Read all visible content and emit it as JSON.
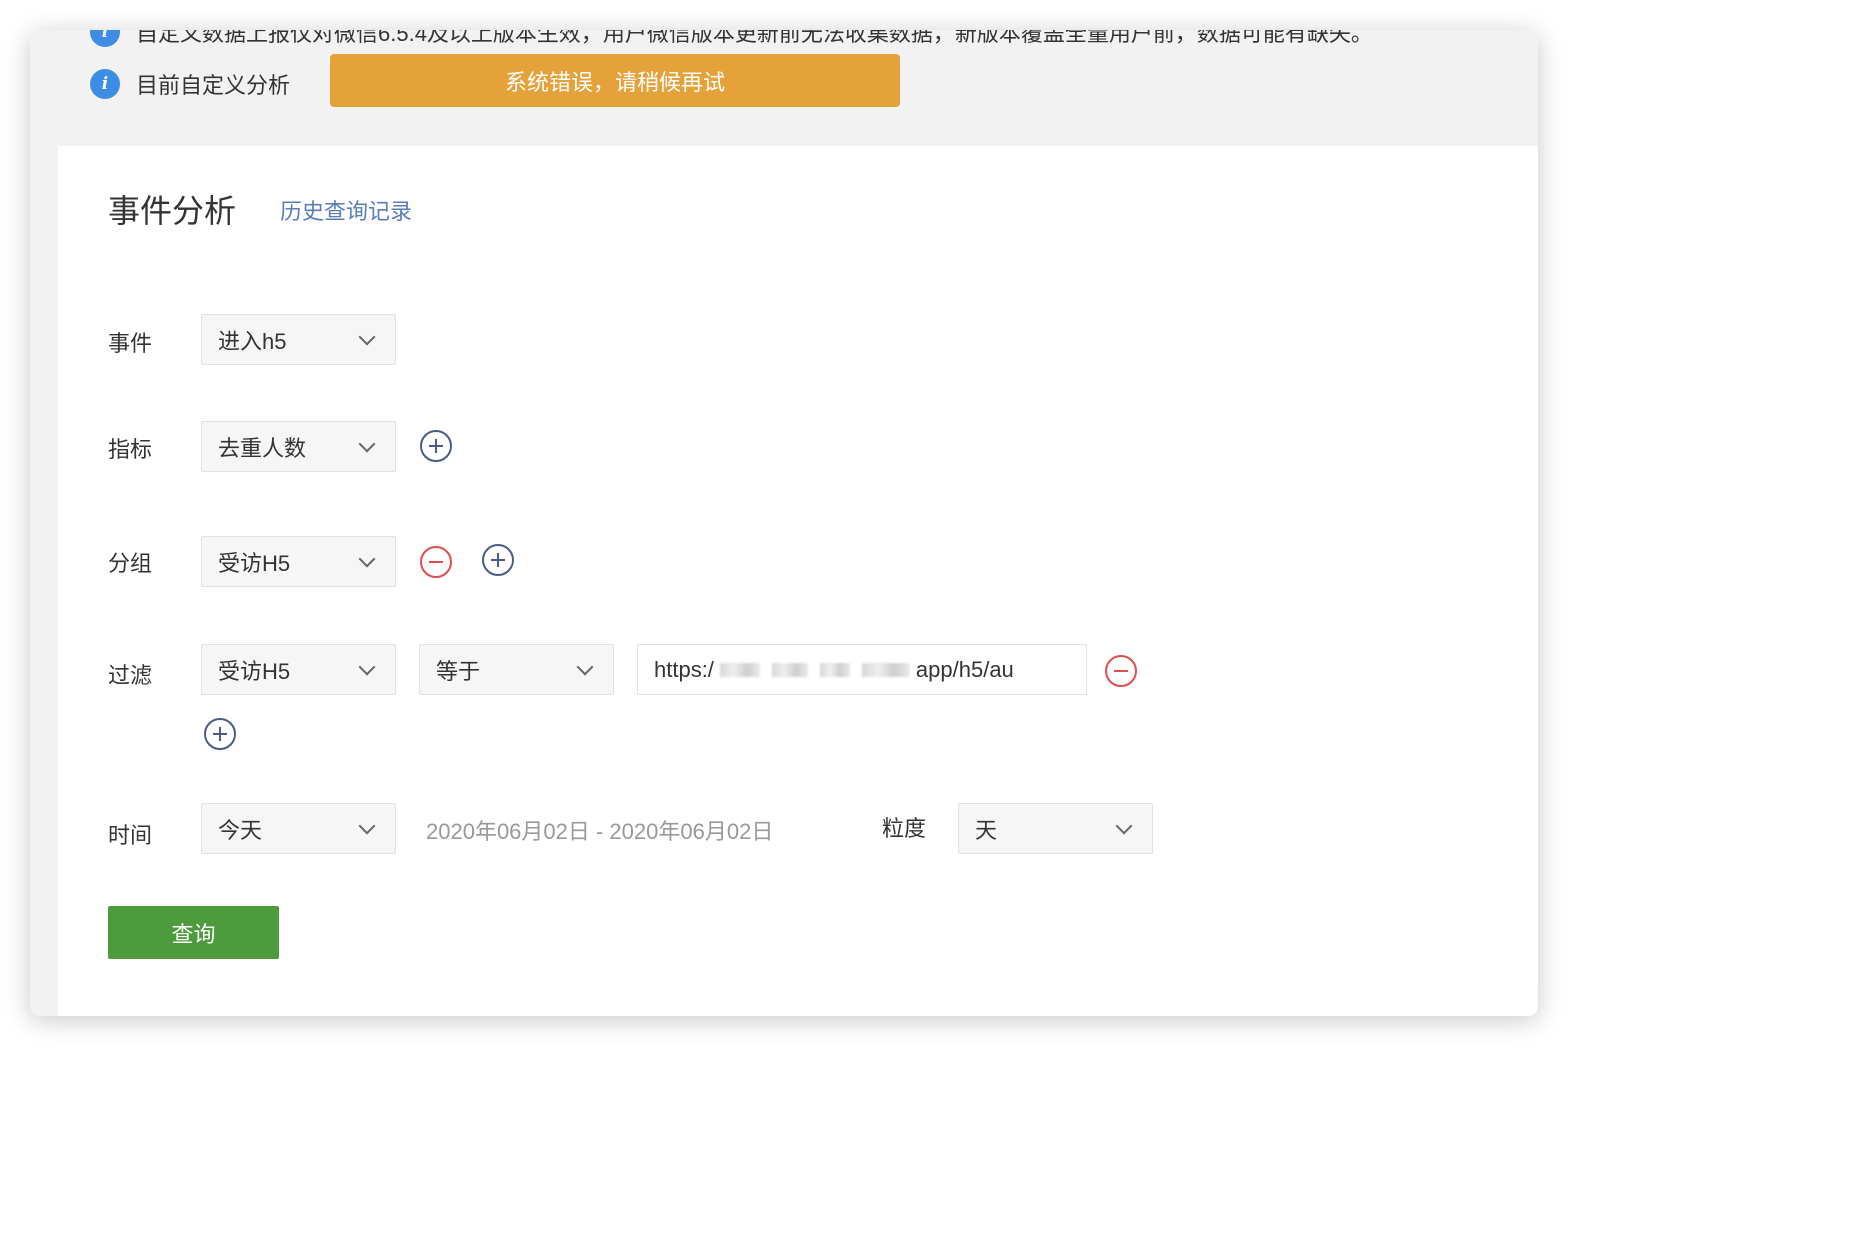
{
  "notices": [
    {
      "text": "自定义数据上报仅对微信6.5.4及以上版本生效，用户微信版本更新前无法收集数据，新版本覆盖全量用户前，数据可能有缺失。"
    },
    {
      "text": "目前自定义分析"
    }
  ],
  "toast": {
    "message": "系统错误，请稍候再试",
    "color": "#e6a23a"
  },
  "page": {
    "title": "事件分析",
    "history_link": "历史查询记录"
  },
  "event": {
    "label": "事件",
    "value": "进入h5"
  },
  "metric": {
    "label": "指标",
    "value": "去重人数"
  },
  "group": {
    "label": "分组",
    "value": "受访H5"
  },
  "filter": {
    "label": "过滤",
    "field": "受访H5",
    "operator": "等于",
    "value_prefix": "https:/",
    "value_suffix": "app/h5/au"
  },
  "time": {
    "label": "时间",
    "preset": "今天",
    "range": "2020年06月02日 - 2020年06月02日",
    "granularity_label": "粒度",
    "granularity": "天"
  },
  "query_button": {
    "label": "查询",
    "color": "#4d9b3c"
  }
}
